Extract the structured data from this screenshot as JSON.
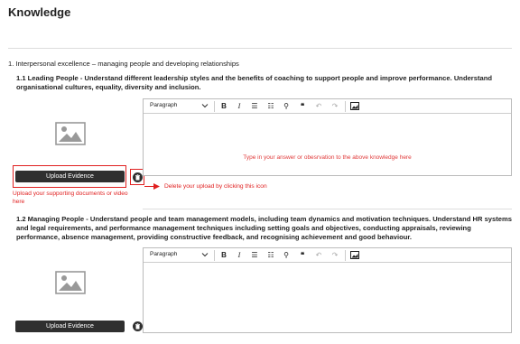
{
  "page": {
    "title": "Knowledge"
  },
  "section": {
    "title": "1. Interpersonal excellence – managing people and developing relationships"
  },
  "items": [
    {
      "title": "1.1 Leading People - Understand different leadership styles and the benefits of coaching to support people and improve performance. Understand organisational cultures, equality, diversity and inclusion.",
      "upload_label": "Upload Evidence",
      "editor": {
        "format_select": "Paragraph",
        "hint": "Type in your answer or obesrvation to the above knowledge here"
      }
    },
    {
      "title": "1.2 Managing People - Understand people and team management models, including team dynamics and motivation techniques. Understand HR systems and legal requirements, and performance management techniques including setting goals and objectives, conducting appraisals, reviewing performance, absence management, providing constructive feedback, and recognising achievement and good behaviour.",
      "upload_label": "Upload Evidence",
      "editor": {
        "format_select": "Paragraph",
        "hint": ""
      }
    }
  ],
  "annotations": {
    "upload_note": "Upload your supporting documents or video here",
    "delete_note": "Delete your upload by clicking this icon"
  },
  "colors": {
    "annotation": "#e02020",
    "button": "#2f2f2f",
    "hint": "#e03a3a"
  },
  "toolbar_icons": [
    "bold-icon",
    "italic-icon",
    "bullet-list-icon",
    "numbered-list-icon",
    "link-icon",
    "quote-icon",
    "undo-icon",
    "redo-icon",
    "image-icon"
  ]
}
